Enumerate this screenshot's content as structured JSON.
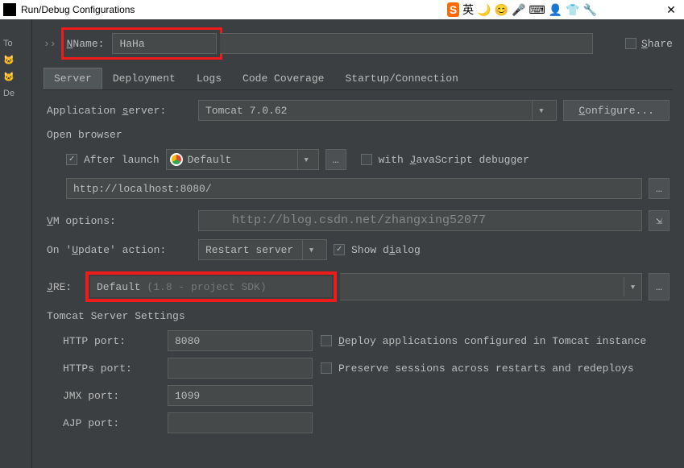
{
  "titlebar": {
    "title": "Run/Debug Configurations",
    "lang_indicator": "英"
  },
  "sidebar": {
    "items": [
      "To",
      "De"
    ]
  },
  "name": {
    "label": "Name:",
    "value": "HaHa"
  },
  "share": {
    "label": "Share"
  },
  "tabs": [
    {
      "label": "Server",
      "active": true
    },
    {
      "label": "Deployment"
    },
    {
      "label": "Logs"
    },
    {
      "label": "Code Coverage"
    },
    {
      "label": "Startup/Connection"
    }
  ],
  "app_server": {
    "label": "Application server:",
    "value": "Tomcat 7.0.62",
    "configure": "Configure..."
  },
  "open_browser": {
    "legend": "Open browser",
    "after_launch": "After launch",
    "browser": "Default",
    "js_debugger": "with JavaScript debugger",
    "url": "http://localhost:8080/"
  },
  "vm_options": {
    "label": "VM options:"
  },
  "watermark": "http://blog.csdn.net/zhangxing52077",
  "update_action": {
    "label": "On 'Update' action:",
    "value": "Restart server",
    "show_dialog": "Show dialog"
  },
  "jre": {
    "label": "JRE:",
    "value": "Default",
    "hint": "(1.8 - project SDK)"
  },
  "tomcat_settings": {
    "legend": "Tomcat Server Settings",
    "http_port_label": "HTTP port:",
    "http_port": "8080",
    "https_port_label": "HTTPs port:",
    "https_port": "",
    "jmx_port_label": "JMX port:",
    "jmx_port": "1099",
    "ajp_port_label": "AJP port:",
    "ajp_port": "",
    "deploy_apps": "Deploy applications configured in Tomcat instance",
    "preserve_sessions": "Preserve sessions across restarts and redeploys"
  }
}
